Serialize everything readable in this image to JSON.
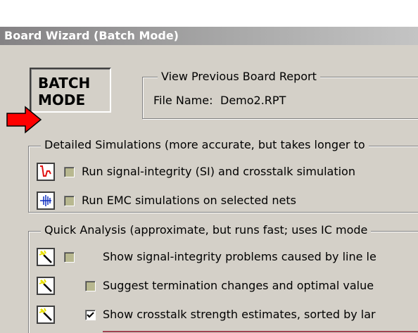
{
  "window": {
    "title": "Board Wizard (Batch Mode)"
  },
  "batch_button": {
    "line1": "BATCH",
    "line2": "MODE"
  },
  "previous_report": {
    "legend": "View Previous Board Report",
    "file_label": "File Name:",
    "file_value": "Demo2.RPT"
  },
  "detailed": {
    "legend": "Detailed Simulations (more accurate, but takes longer to",
    "items": [
      {
        "icon": "waveform-icon",
        "checked": false,
        "enabled": false,
        "label": "Run signal-integrity (SI) and crosstalk simulation"
      },
      {
        "icon": "emc-spectrum-icon",
        "checked": false,
        "enabled": false,
        "label": "Run EMC simulations on selected nets"
      }
    ]
  },
  "quick": {
    "legend": "Quick Analysis (approximate, but runs fast; uses IC mode",
    "items": [
      {
        "icon": "magic-wand-icon",
        "checked": false,
        "enabled": false,
        "label": "Show signal-integrity problems caused by line le"
      },
      {
        "icon": "magic-wand-icon",
        "checked": false,
        "enabled": false,
        "label": "Suggest termination changes and optimal value"
      },
      {
        "icon": "magic-wand-icon",
        "checked": true,
        "enabled": true,
        "label": "Show crosstalk strength estimates, sorted by lar"
      }
    ]
  },
  "annotation": {
    "arrow_color": "#ff0000",
    "line_color": "#a04050"
  }
}
